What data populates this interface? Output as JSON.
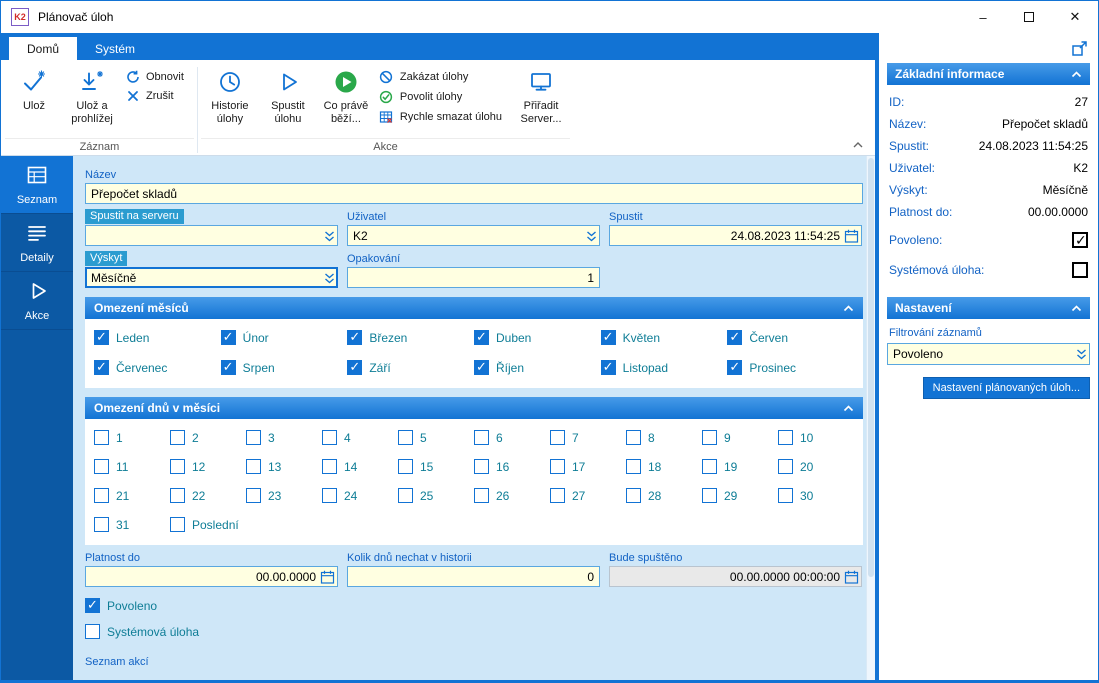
{
  "colors": {
    "accent": "#1273d4",
    "sidebar": "#0c59a4",
    "main_background": "#cfe7f8",
    "field_background": "#ffffe1",
    "label_highlight": "#2b9cd0",
    "checkbox_label": "#0e7d96",
    "success_green": "#2aa84a"
  },
  "window": {
    "title": "Plánovač úloh",
    "logo_text": "K2",
    "controls": {
      "minimize": "–",
      "close": "✕"
    }
  },
  "tabs": {
    "home": "Domů",
    "system": "Systém"
  },
  "ribbon": {
    "save": "Ulož",
    "save_and_view": "Ulož a prohlížej",
    "refresh": "Obnovit",
    "cancel": "Zrušit",
    "group_record": "Záznam",
    "history": "Historie úlohy",
    "run_task": "Spustit úlohu",
    "whats_running": "Co právě běží...",
    "disable_tasks": "Zakázat úlohy",
    "enable_tasks": "Povolit úlohy",
    "quick_delete": "Rychle smazat úlohu",
    "assign_server": "Přiřadit Server...",
    "group_actions": "Akce"
  },
  "sidebar": {
    "items": [
      {
        "label": "Seznam"
      },
      {
        "label": "Detaily"
      },
      {
        "label": "Akce"
      }
    ]
  },
  "form": {
    "name": {
      "label": "Název",
      "value": "Přepočet skladů"
    },
    "server": {
      "label": "Spustit na serveru",
      "value": ""
    },
    "user": {
      "label": "Uživatel",
      "value": "K2"
    },
    "start": {
      "label": "Spustit",
      "value": "24.08.2023 11:54:25"
    },
    "occurrence": {
      "label": "Výskyt",
      "value": "Měsíčně"
    },
    "repeat": {
      "label": "Opakování",
      "value": "1"
    },
    "months_section": "Omezení měsíců",
    "months": [
      {
        "label": "Leden",
        "checked": true
      },
      {
        "label": "Únor",
        "checked": true
      },
      {
        "label": "Březen",
        "checked": true
      },
      {
        "label": "Duben",
        "checked": true
      },
      {
        "label": "Květen",
        "checked": true
      },
      {
        "label": "Červen",
        "checked": true
      },
      {
        "label": "Červenec",
        "checked": true
      },
      {
        "label": "Srpen",
        "checked": true
      },
      {
        "label": "Září",
        "checked": true
      },
      {
        "label": "Říjen",
        "checked": true
      },
      {
        "label": "Listopad",
        "checked": true
      },
      {
        "label": "Prosinec",
        "checked": true
      }
    ],
    "days_section": "Omezení dnů v měsíci",
    "days": [
      {
        "label": "1",
        "checked": false
      },
      {
        "label": "2",
        "checked": false
      },
      {
        "label": "3",
        "checked": false
      },
      {
        "label": "4",
        "checked": false
      },
      {
        "label": "5",
        "checked": false
      },
      {
        "label": "6",
        "checked": false
      },
      {
        "label": "7",
        "checked": false
      },
      {
        "label": "8",
        "checked": false
      },
      {
        "label": "9",
        "checked": false
      },
      {
        "label": "10",
        "checked": false
      },
      {
        "label": "11",
        "checked": false
      },
      {
        "label": "12",
        "checked": false
      },
      {
        "label": "13",
        "checked": false
      },
      {
        "label": "14",
        "checked": false
      },
      {
        "label": "15",
        "checked": false
      },
      {
        "label": "16",
        "checked": false
      },
      {
        "label": "17",
        "checked": false
      },
      {
        "label": "18",
        "checked": false
      },
      {
        "label": "19",
        "checked": false
      },
      {
        "label": "20",
        "checked": false
      },
      {
        "label": "21",
        "checked": false
      },
      {
        "label": "22",
        "checked": false
      },
      {
        "label": "23",
        "checked": false
      },
      {
        "label": "24",
        "checked": false
      },
      {
        "label": "25",
        "checked": false
      },
      {
        "label": "26",
        "checked": false
      },
      {
        "label": "27",
        "checked": false
      },
      {
        "label": "28",
        "checked": false
      },
      {
        "label": "29",
        "checked": false
      },
      {
        "label": "30",
        "checked": false
      },
      {
        "label": "31",
        "checked": false
      },
      {
        "label": "Poslední",
        "checked": false
      }
    ],
    "valid_until": {
      "label": "Platnost do",
      "value": "00.00.0000"
    },
    "history_days": {
      "label": "Kolik dnů nechat v historii",
      "value": "0"
    },
    "will_run": {
      "label": "Bude spuštěno",
      "value": "00.00.0000 00:00:00"
    },
    "enabled": {
      "label": "Povoleno",
      "checked": true
    },
    "system_task": {
      "label": "Systémová úloha",
      "checked": false
    },
    "actions_list_label": "Seznam akcí"
  },
  "info_panel": {
    "title": "Základní informace",
    "rows": [
      {
        "label": "ID:",
        "value": "27"
      },
      {
        "label": "Název:",
        "value": "Přepočet skladů"
      },
      {
        "label": "Spustit:",
        "value": "24.08.2023 11:54:25"
      },
      {
        "label": "Uživatel:",
        "value": "K2"
      },
      {
        "label": "Výskyt:",
        "value": "Měsíčně"
      },
      {
        "label": "Platnost do:",
        "value": "00.00.0000"
      }
    ],
    "enabled": {
      "label": "Povoleno:",
      "checked": true
    },
    "system": {
      "label": "Systémová úloha:",
      "checked": false
    }
  },
  "settings_panel": {
    "title": "Nastavení",
    "filter_label": "Filtrování záznamů",
    "filter_value": "Povoleno",
    "button": "Nastavení plánovaných úloh..."
  }
}
